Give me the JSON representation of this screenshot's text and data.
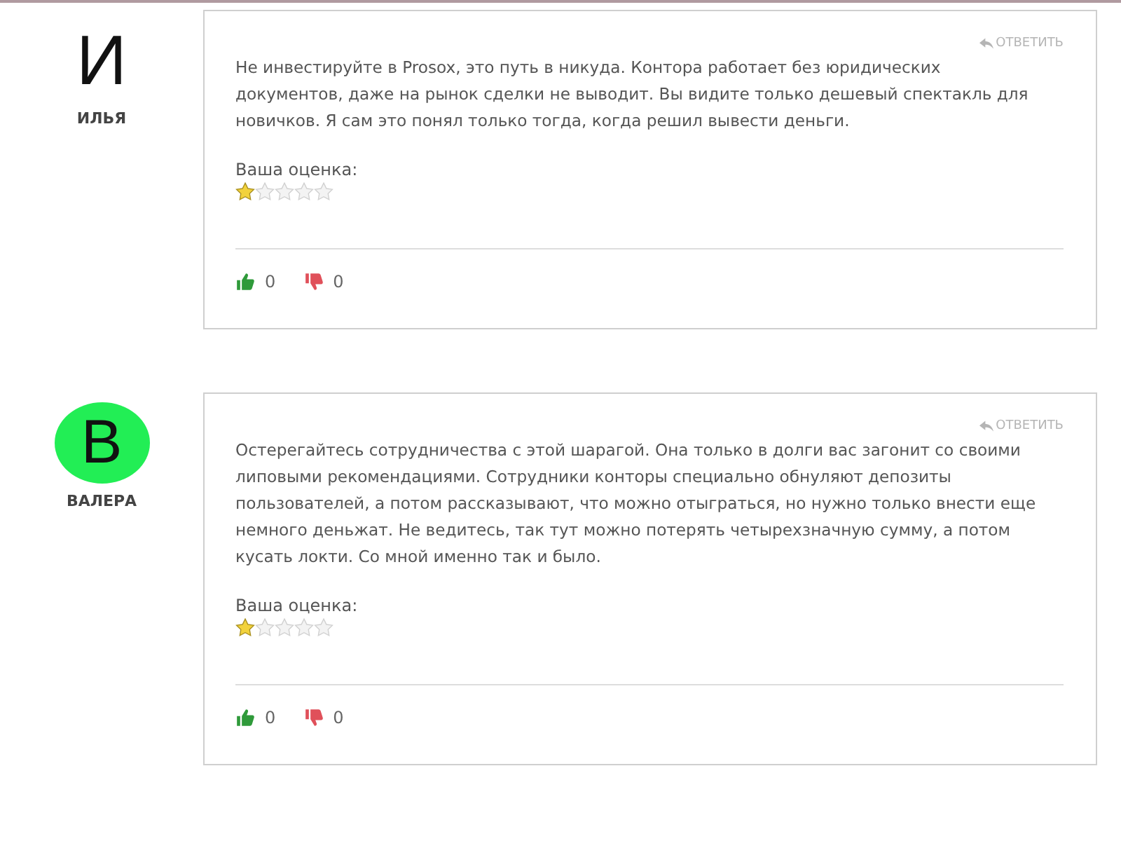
{
  "comments": [
    {
      "avatar": {
        "letter": "И",
        "kind": "plain"
      },
      "author": "ИЛЬЯ",
      "reply": "ОТВЕТИТЬ",
      "text": "Не инвестируйте в Prosox, это путь в никуда. Контора работает без юридических\nдокументов, даже на рынок сделки не выводит. Вы видите только дешевый спектакль для\nновичков. Я сам это понял только тогда, когда решил вывести деньги.",
      "rating_label": "Ваша оценка:",
      "stars": 1,
      "likes": "0",
      "dislikes": "0"
    },
    {
      "avatar": {
        "letter": "В",
        "kind": "circle",
        "color": "#22ee55"
      },
      "author": "ВАЛЕРА",
      "reply": "ОТВЕТИТЬ",
      "text": "Остерегайтесь сотрудничества с этой шарагой. Она только в долги вас загонит со своими\nлиповыми рекомендациями. Сотрудники конторы специально обнуляют депозиты\nпользователей, а потом рассказывают, что можно отыграться, но нужно только внести еще\nнемного деньжат. Не ведитесь, так тут можно потерять четырехзначную сумму, а потом\nкусать локти. Со мной именно так и было.",
      "rating_label": "Ваша оценка:",
      "stars": 1,
      "likes": "0",
      "dislikes": "0"
    }
  ]
}
